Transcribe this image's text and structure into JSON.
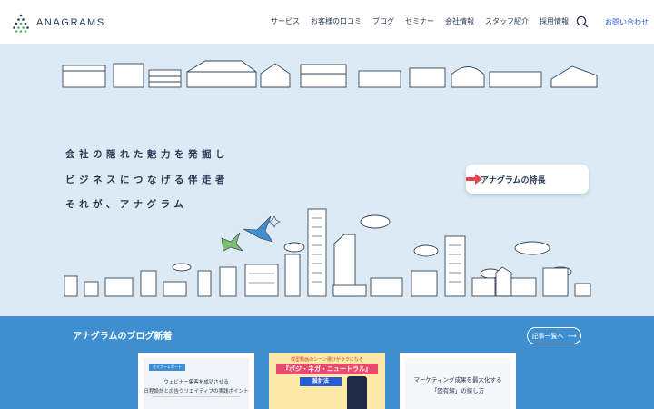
{
  "header": {
    "logo_text": "ANAGRAMS",
    "nav": [
      "サービス",
      "お客様の口コミ",
      "ブログ",
      "セミナー",
      "会社情報",
      "スタッフ紹介",
      "採用情報"
    ],
    "contact": "お問い合わせ"
  },
  "hero": {
    "tagline": [
      "会社の隠れた魅力を発掘し",
      "ビジネスにつなげる伴走者",
      "それが、アナグラム"
    ],
    "feature_button": "アナグラムの特長"
  },
  "blog": {
    "title": "アナグラムのブログ新着",
    "all_posts": "記事一覧へ",
    "cards": [
      {
        "tag": "セミナーレポート",
        "line1": "ウェビナー集客を成功させる",
        "line2": "日程設計と広告クリエイティブの実践ポイント"
      },
      {
        "head": "縦型動画のシーン選びがラクになる",
        "banner": "『ポジ・ネガ・ニュートラル』",
        "sub": "設計法"
      },
      {
        "line1": "マーケティング成果を最大化する",
        "line2": "「固有解」の探し方"
      }
    ]
  },
  "colors": {
    "hero_bg": "#dbeaf5",
    "blog_bg": "#3f8fd0",
    "accent_red": "#e04a55",
    "link_blue": "#2a5bd7"
  }
}
